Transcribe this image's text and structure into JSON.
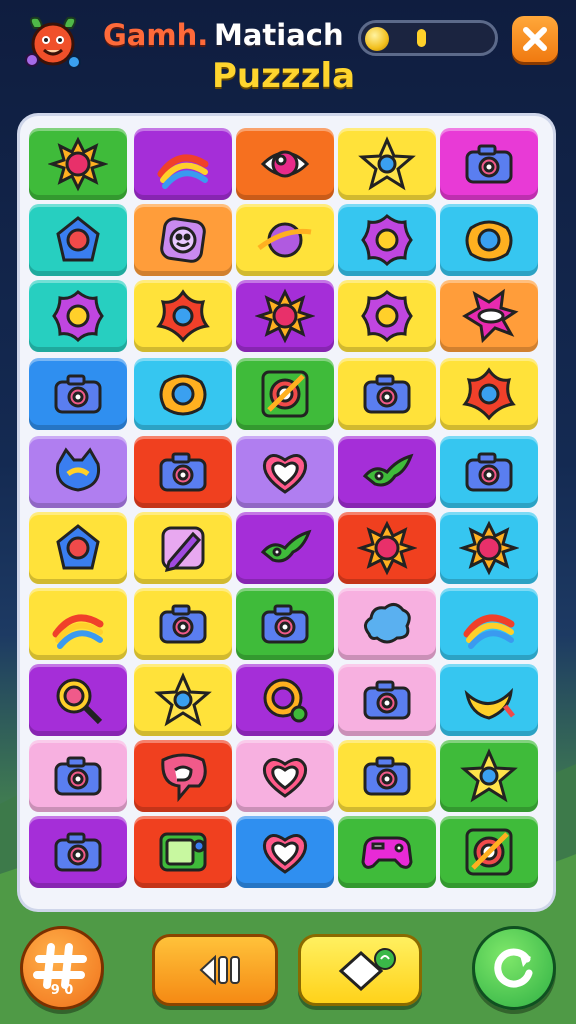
{
  "header": {
    "title_part1": "Gamh.",
    "title_part2": "Matiach",
    "title_part3": "Puzzzla",
    "progress_level": 0.04
  },
  "colors": {
    "green": "#3fbb3a",
    "purple": "#a52ed8",
    "orange": "#f6701f",
    "yellow": "#ffe23a",
    "magenta": "#e83ad6",
    "teal": "#27cfc0",
    "lightorange": "#ff9d3a",
    "cyan": "#36c6f0",
    "blue": "#2f8ff0",
    "red": "#f0401f",
    "lavender": "#b07ef0",
    "pink": "#f7b0e0"
  },
  "board": {
    "rows": [
      [
        {
          "bg": "green",
          "icon": "sun-flower-icon"
        },
        {
          "bg": "purple",
          "icon": "rainbow-icon"
        },
        {
          "bg": "orange",
          "icon": "orb-icon"
        },
        {
          "bg": "yellow",
          "icon": "star-icon"
        },
        {
          "bg": "magenta",
          "icon": "camera-icon"
        }
      ],
      [
        {
          "bg": "teal",
          "icon": "gem-icon"
        },
        {
          "bg": "lightorange",
          "icon": "smiley-icon"
        },
        {
          "bg": "yellow",
          "icon": "planet-icon"
        },
        {
          "bg": "cyan",
          "icon": "flower-icon"
        },
        {
          "bg": "cyan",
          "icon": "blob-icon"
        }
      ],
      [
        {
          "bg": "teal",
          "icon": "flower-icon"
        },
        {
          "bg": "yellow",
          "icon": "star-flower-icon"
        },
        {
          "bg": "purple",
          "icon": "sun-flower-icon"
        },
        {
          "bg": "yellow",
          "icon": "flower-icon"
        },
        {
          "bg": "lightorange",
          "icon": "burst-icon"
        }
      ],
      [
        {
          "bg": "blue",
          "icon": "camera-icon"
        },
        {
          "bg": "cyan",
          "icon": "blob-icon"
        },
        {
          "bg": "green",
          "icon": "target-icon"
        },
        {
          "bg": "yellow",
          "icon": "camera-icon"
        },
        {
          "bg": "yellow",
          "icon": "star-flower-icon"
        }
      ],
      [
        {
          "bg": "lavender",
          "icon": "cat-icon"
        },
        {
          "bg": "red",
          "icon": "camera-icon"
        },
        {
          "bg": "lavender",
          "icon": "heart-icon"
        },
        {
          "bg": "purple",
          "icon": "bird-icon"
        },
        {
          "bg": "cyan",
          "icon": "camera-icon"
        }
      ],
      [
        {
          "bg": "yellow",
          "icon": "gem-icon"
        },
        {
          "bg": "yellow",
          "icon": "pencil-icon"
        },
        {
          "bg": "purple",
          "icon": "bird-icon"
        },
        {
          "bg": "red",
          "icon": "sun-flower-icon"
        },
        {
          "bg": "cyan",
          "icon": "sun-flower-icon"
        }
      ],
      [
        {
          "bg": "yellow",
          "icon": "rainbow-icon"
        },
        {
          "bg": "yellow",
          "icon": "camera-icon"
        },
        {
          "bg": "green",
          "icon": "camera-icon"
        },
        {
          "bg": "pink",
          "icon": "cloud-icon"
        },
        {
          "bg": "cyan",
          "icon": "rainbow-icon"
        }
      ],
      [
        {
          "bg": "purple",
          "icon": "magnifier-icon"
        },
        {
          "bg": "yellow",
          "icon": "star-icon"
        },
        {
          "bg": "purple",
          "icon": "ring-icon"
        },
        {
          "bg": "pink",
          "icon": "camera-icon"
        },
        {
          "bg": "cyan",
          "icon": "banana-icon"
        }
      ],
      [
        {
          "bg": "pink",
          "icon": "camera-icon"
        },
        {
          "bg": "red",
          "icon": "speech-bubble-icon"
        },
        {
          "bg": "pink",
          "icon": "heart-icon"
        },
        {
          "bg": "yellow",
          "icon": "camera-icon"
        },
        {
          "bg": "green",
          "icon": "star-icon"
        }
      ],
      [
        {
          "bg": "purple",
          "icon": "camera-icon"
        },
        {
          "bg": "red",
          "icon": "tv-icon"
        },
        {
          "bg": "blue",
          "icon": "heart-icon"
        },
        {
          "bg": "green",
          "icon": "gamepad-icon"
        },
        {
          "bg": "green",
          "icon": "target-icon"
        }
      ]
    ]
  },
  "footer": {
    "shuffle_number": "9 0",
    "buttons": [
      {
        "name": "shuffle-button",
        "icon": "hash-icon"
      },
      {
        "name": "rewind-button",
        "icon": "rewind-icon"
      },
      {
        "name": "hint-button",
        "icon": "tag-icon"
      },
      {
        "name": "restart-button",
        "icon": "restart-icon"
      }
    ]
  }
}
